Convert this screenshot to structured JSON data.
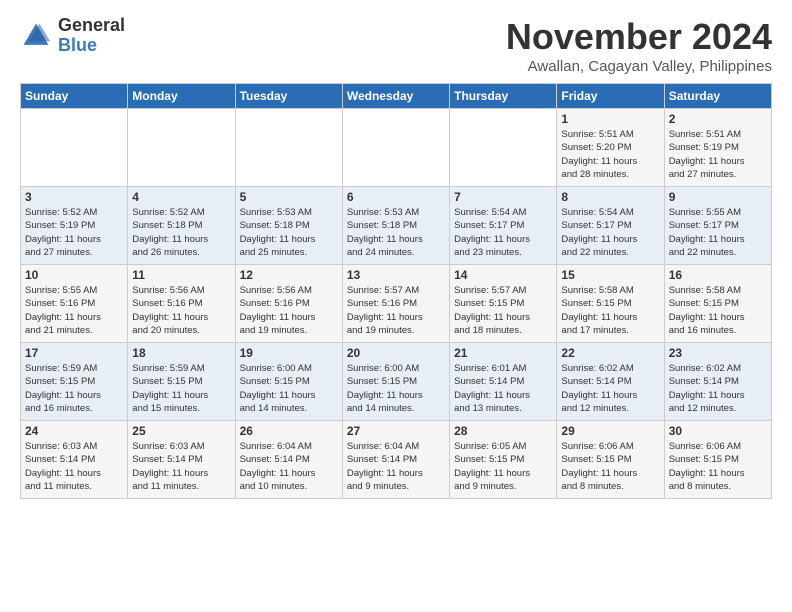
{
  "logo": {
    "line1": "General",
    "line2": "Blue"
  },
  "title": "November 2024",
  "location": "Awallan, Cagayan Valley, Philippines",
  "days_of_week": [
    "Sunday",
    "Monday",
    "Tuesday",
    "Wednesday",
    "Thursday",
    "Friday",
    "Saturday"
  ],
  "weeks": [
    [
      {
        "day": "",
        "info": ""
      },
      {
        "day": "",
        "info": ""
      },
      {
        "day": "",
        "info": ""
      },
      {
        "day": "",
        "info": ""
      },
      {
        "day": "",
        "info": ""
      },
      {
        "day": "1",
        "info": "Sunrise: 5:51 AM\nSunset: 5:20 PM\nDaylight: 11 hours\nand 28 minutes."
      },
      {
        "day": "2",
        "info": "Sunrise: 5:51 AM\nSunset: 5:19 PM\nDaylight: 11 hours\nand 27 minutes."
      }
    ],
    [
      {
        "day": "3",
        "info": "Sunrise: 5:52 AM\nSunset: 5:19 PM\nDaylight: 11 hours\nand 27 minutes."
      },
      {
        "day": "4",
        "info": "Sunrise: 5:52 AM\nSunset: 5:18 PM\nDaylight: 11 hours\nand 26 minutes."
      },
      {
        "day": "5",
        "info": "Sunrise: 5:53 AM\nSunset: 5:18 PM\nDaylight: 11 hours\nand 25 minutes."
      },
      {
        "day": "6",
        "info": "Sunrise: 5:53 AM\nSunset: 5:18 PM\nDaylight: 11 hours\nand 24 minutes."
      },
      {
        "day": "7",
        "info": "Sunrise: 5:54 AM\nSunset: 5:17 PM\nDaylight: 11 hours\nand 23 minutes."
      },
      {
        "day": "8",
        "info": "Sunrise: 5:54 AM\nSunset: 5:17 PM\nDaylight: 11 hours\nand 22 minutes."
      },
      {
        "day": "9",
        "info": "Sunrise: 5:55 AM\nSunset: 5:17 PM\nDaylight: 11 hours\nand 22 minutes."
      }
    ],
    [
      {
        "day": "10",
        "info": "Sunrise: 5:55 AM\nSunset: 5:16 PM\nDaylight: 11 hours\nand 21 minutes."
      },
      {
        "day": "11",
        "info": "Sunrise: 5:56 AM\nSunset: 5:16 PM\nDaylight: 11 hours\nand 20 minutes."
      },
      {
        "day": "12",
        "info": "Sunrise: 5:56 AM\nSunset: 5:16 PM\nDaylight: 11 hours\nand 19 minutes."
      },
      {
        "day": "13",
        "info": "Sunrise: 5:57 AM\nSunset: 5:16 PM\nDaylight: 11 hours\nand 19 minutes."
      },
      {
        "day": "14",
        "info": "Sunrise: 5:57 AM\nSunset: 5:15 PM\nDaylight: 11 hours\nand 18 minutes."
      },
      {
        "day": "15",
        "info": "Sunrise: 5:58 AM\nSunset: 5:15 PM\nDaylight: 11 hours\nand 17 minutes."
      },
      {
        "day": "16",
        "info": "Sunrise: 5:58 AM\nSunset: 5:15 PM\nDaylight: 11 hours\nand 16 minutes."
      }
    ],
    [
      {
        "day": "17",
        "info": "Sunrise: 5:59 AM\nSunset: 5:15 PM\nDaylight: 11 hours\nand 16 minutes."
      },
      {
        "day": "18",
        "info": "Sunrise: 5:59 AM\nSunset: 5:15 PM\nDaylight: 11 hours\nand 15 minutes."
      },
      {
        "day": "19",
        "info": "Sunrise: 6:00 AM\nSunset: 5:15 PM\nDaylight: 11 hours\nand 14 minutes."
      },
      {
        "day": "20",
        "info": "Sunrise: 6:00 AM\nSunset: 5:15 PM\nDaylight: 11 hours\nand 14 minutes."
      },
      {
        "day": "21",
        "info": "Sunrise: 6:01 AM\nSunset: 5:14 PM\nDaylight: 11 hours\nand 13 minutes."
      },
      {
        "day": "22",
        "info": "Sunrise: 6:02 AM\nSunset: 5:14 PM\nDaylight: 11 hours\nand 12 minutes."
      },
      {
        "day": "23",
        "info": "Sunrise: 6:02 AM\nSunset: 5:14 PM\nDaylight: 11 hours\nand 12 minutes."
      }
    ],
    [
      {
        "day": "24",
        "info": "Sunrise: 6:03 AM\nSunset: 5:14 PM\nDaylight: 11 hours\nand 11 minutes."
      },
      {
        "day": "25",
        "info": "Sunrise: 6:03 AM\nSunset: 5:14 PM\nDaylight: 11 hours\nand 11 minutes."
      },
      {
        "day": "26",
        "info": "Sunrise: 6:04 AM\nSunset: 5:14 PM\nDaylight: 11 hours\nand 10 minutes."
      },
      {
        "day": "27",
        "info": "Sunrise: 6:04 AM\nSunset: 5:14 PM\nDaylight: 11 hours\nand 9 minutes."
      },
      {
        "day": "28",
        "info": "Sunrise: 6:05 AM\nSunset: 5:15 PM\nDaylight: 11 hours\nand 9 minutes."
      },
      {
        "day": "29",
        "info": "Sunrise: 6:06 AM\nSunset: 5:15 PM\nDaylight: 11 hours\nand 8 minutes."
      },
      {
        "day": "30",
        "info": "Sunrise: 6:06 AM\nSunset: 5:15 PM\nDaylight: 11 hours\nand 8 minutes."
      }
    ]
  ]
}
